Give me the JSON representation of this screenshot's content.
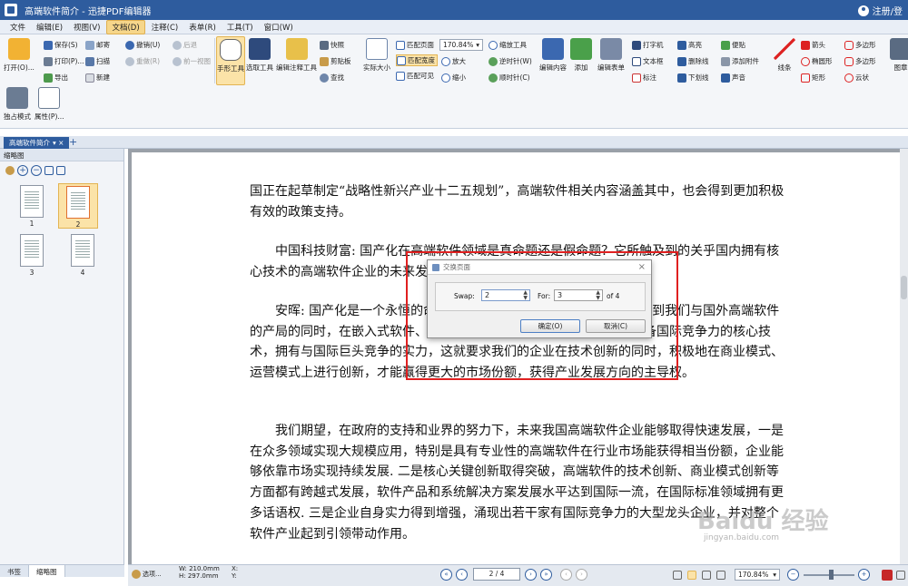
{
  "titlebar": {
    "doc_name": "高端软件简介",
    "app_name": "迅捷PDF编辑器",
    "separator": " - ",
    "user_link": "注册/登"
  },
  "menu": [
    "文件",
    "编辑(E)",
    "视图(V)",
    "文档(D)",
    "注释(C)",
    "表单(R)",
    "工具(T)",
    "窗口(W)"
  ],
  "ribbon": {
    "open": "打开(O)...",
    "save": "保存(S)",
    "print": "打印(P)...",
    "export": "导出",
    "mail": "邮寄",
    "scan": "扫描",
    "new": "新建",
    "undo": "撤销(U)",
    "redo": "重做(R)",
    "back": "后退",
    "forward": "前一视图",
    "hand_tool": "手形工具",
    "select_text": "选取工具",
    "edit_annot": "编辑注释工具",
    "snapshot": "快照",
    "clipboard": "剪贴板",
    "find": "查找",
    "actual_size": "实际大小",
    "fit_page": "匹配页面",
    "fit_width": "匹配宽度",
    "fit_visible": "匹配可见",
    "zoom_value": "170.84%",
    "zoom_in": "放大",
    "zoom_out": "缩小",
    "zoom_tool": "缩放工具",
    "rotate_ccw": "逆时针(W)",
    "rotate_cw": "顺时针(C)",
    "edit_content": "编辑内容",
    "add": "添加",
    "edit_form": "编辑表单",
    "typewriter": "打字机",
    "textbox": "文本框",
    "callout": "标注",
    "highlight": "高亮",
    "strikeout": "删除线",
    "underline": "下划线",
    "note": "便贴",
    "attach": "添加附件",
    "sound": "声音",
    "line": "线条",
    "arrow": "箭头",
    "ellipse": "椭圆形",
    "rect": "矩形",
    "polygon": "多边形",
    "polyline": "多边形",
    "cloud": "云状",
    "stamp": "图章",
    "exclusive": "独占模式",
    "properties": "属性(P)..."
  },
  "doc_tab": "高端软件简介",
  "sidebar": {
    "title": "缩略图",
    "pages": [
      "1",
      "2",
      "3",
      "4"
    ],
    "tabs": [
      "书签",
      "缩略图"
    ]
  },
  "paragraphs": [
    "国正在起草制定“战略性新兴产业十二五规划”，高端软件相关内容涵盖其中，也会得到更加积极有效的政策支持。",
    "中国科技财富: 国产化在高端软件领域是真命题还是假命题？它所触及到的关乎国内拥有核心技术的高端软件企业的未来发展的命运，您对此会抱怎样的期望？",
    "安晖: 国产化是一个永恒的命题，也是我们努力的一个目标。在认识到我们与国外高端软件的产局的同时，在嵌入式软件、企业管理软件等领域，我们已经拥有具备国际竞争力的核心技术，拥有与国际巨头竞争的实力，这就要求我们的企业在技术创新的同时，积极地在商业模式、运营模式上进行创新，才能赢得更大的市场份额，获得产业发展方向的主导权。",
    "我们期望，在政府的支持和业界的努力下，未来我国高端软件企业能够取得快速发展，一是在众多领域实现大规模应用，特别是具有专业性的高端软件在行业市场能获得相当份额，企业能够依靠市场实现持续发展. 二是核心关键创新取得突破，高端软件的技术创新、商业模式创新等方面都有跨越式发展，软件产品和系统解决方案发展水平达到国际一流，在国际标准领域拥有更多话语权. 三是企业自身实力得到增强，涌现出若干家有国际竞争力的大型龙头企业，并对整个软件产业起到引领带动作用。"
  ],
  "dialog": {
    "title": "交换页面",
    "swap_label": "Swap:",
    "swap_value": "2",
    "for_label": "For:",
    "for_value": "3",
    "of_text": "of 4",
    "ok": "确定(O)",
    "cancel": "取消(C)"
  },
  "status": {
    "options": "选项...",
    "width": "W: 210.0mm",
    "height": "H: 297.0mm",
    "x": "X:",
    "y": "Y:",
    "page": "2 / 4",
    "zoom": "170.84%"
  },
  "watermark": {
    "text": "Baidu 经验",
    "url": "jingyan.baidu.com"
  }
}
